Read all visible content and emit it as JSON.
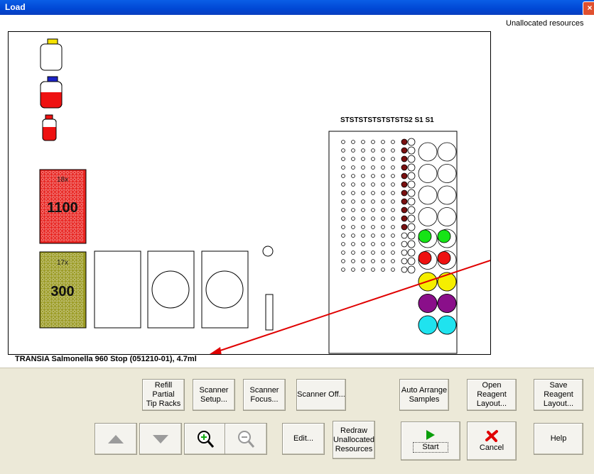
{
  "window": {
    "title": "Load",
    "close_glyph": "×"
  },
  "deck": {
    "unallocated_label": "Unallocated resources",
    "rack1": {
      "count": "18x",
      "value": "1100",
      "color": "#e8231f"
    },
    "rack2": {
      "count": "17x",
      "value": "300",
      "color": "#9a9a22"
    },
    "column_header": "STSTSTSTSTSTSTS2 S1  S1"
  },
  "status_text": "TRANSIA Salmonella 960 Stop (051210-01), 4.7ml",
  "buttons": {
    "refill": "Refill Partial\nTip Racks",
    "scanner_setup": "Scanner\nSetup...",
    "scanner_focus": "Scanner\nFocus...",
    "scanner_off": "Scanner Off...",
    "auto_arrange": "Auto Arrange\nSamples",
    "open_layout": "Open Reagent\nLayout...",
    "save_layout": "Save Reagent\nLayout...",
    "edit": "Edit...",
    "redraw": "Redraw\nUnallocated\nResources",
    "start": "Start",
    "cancel": "Cancel",
    "help": "Help"
  },
  "colors": {
    "green": "#16e416",
    "red": "#ee1111",
    "yellow": "#f5ee00",
    "purple": "#8a0f8a",
    "cyan": "#1fe3ef",
    "dark_red": "#7a1010"
  }
}
